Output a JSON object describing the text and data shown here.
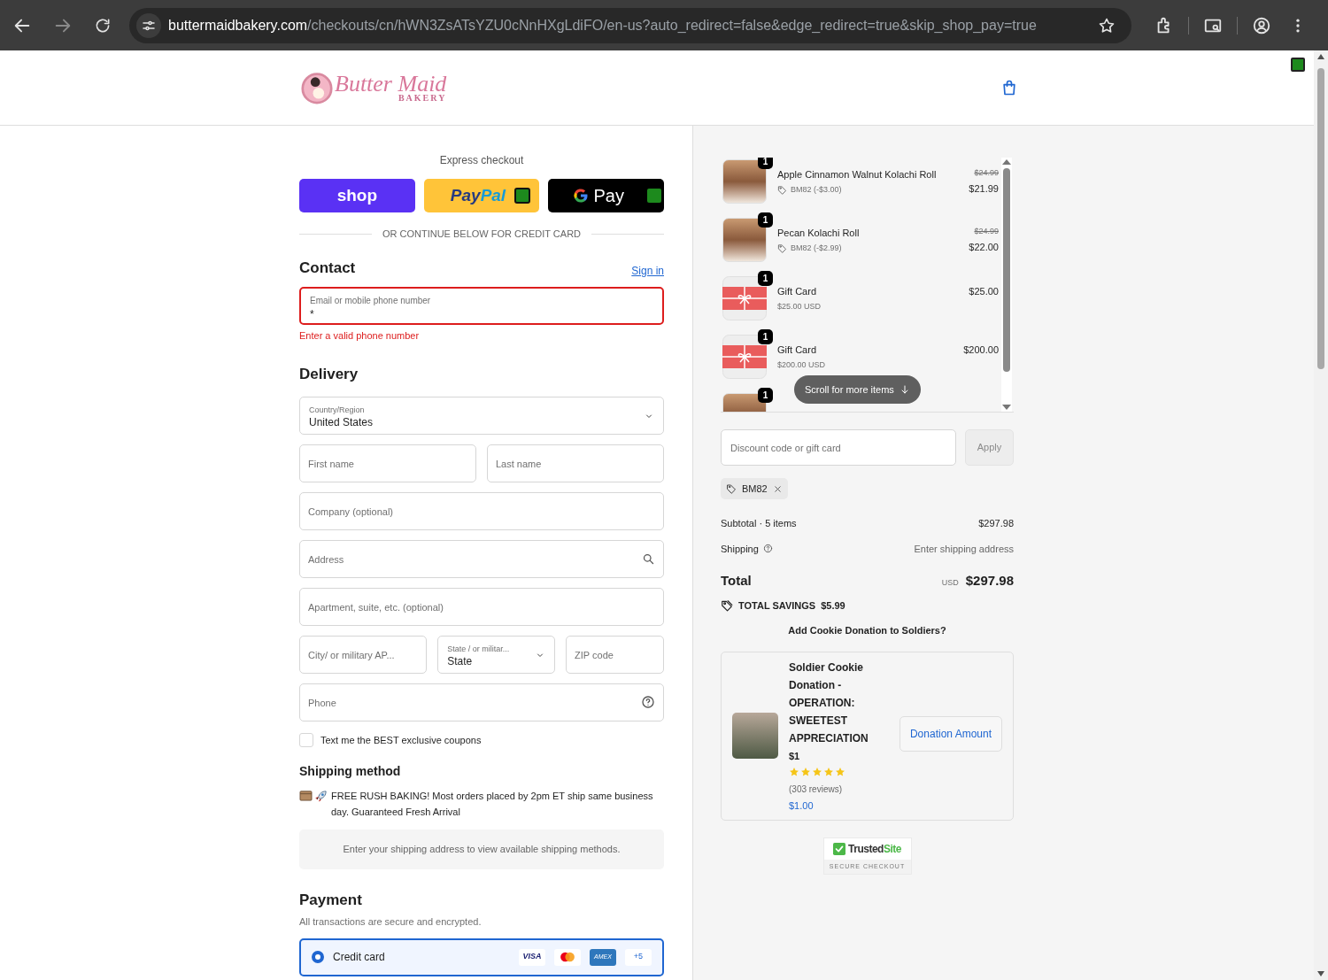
{
  "browser": {
    "url_host": "buttermaidbakery.com",
    "url_rest": "/checkouts/cn/hWN3ZsATsYZU0cNnHXgLdiFO/en-us?auto_redirect=false&edge_redirect=true&skip_shop_pay=true"
  },
  "header": {
    "logo_script": "Butter Maid",
    "logo_sub": "BAKERY"
  },
  "express": {
    "title": "Express checkout",
    "divider": "OR CONTINUE BELOW FOR CREDIT CARD",
    "buttons": [
      {
        "kind": "shop",
        "parts": [
          "shop"
        ]
      },
      {
        "kind": "paypal",
        "parts": [
          "Pay",
          "Pal"
        ]
      },
      {
        "kind": "gpay",
        "parts": [
          "Pay"
        ]
      }
    ]
  },
  "contact": {
    "title": "Contact",
    "sign_in": "Sign in",
    "field": {
      "label": "Email or mobile phone number",
      "value": "*",
      "invalid": true
    },
    "error": "Enter a valid phone number"
  },
  "delivery": {
    "title": "Delivery",
    "rows": [
      [
        {
          "kind": "select",
          "label": "Country/Region",
          "value": "United States"
        }
      ],
      [
        {
          "kind": "text",
          "placeholder": "First name"
        },
        {
          "kind": "text",
          "placeholder": "Last name"
        }
      ],
      [
        {
          "kind": "text",
          "placeholder": "Company (optional)"
        }
      ],
      [
        {
          "kind": "search",
          "placeholder": "Address"
        }
      ],
      [
        {
          "kind": "text",
          "placeholder": "Apartment, suite, etc. (optional)"
        }
      ],
      [
        {
          "kind": "text",
          "placeholder": "City/ or military AP..."
        },
        {
          "kind": "select",
          "label": "State / or militar...",
          "value": "State"
        },
        {
          "kind": "text",
          "placeholder": "ZIP code"
        }
      ],
      [
        {
          "kind": "help",
          "placeholder": "Phone"
        }
      ]
    ],
    "checkbox": {
      "label": "Text me the BEST exclusive coupons",
      "checked": false
    }
  },
  "shipping_method": {
    "title": "Shipping method",
    "note": "FREE RUSH BAKING! Most orders placed by 2pm ET ship same business day. Guaranteed Fresh Arrival",
    "info": "Enter your shipping address to view available shipping methods."
  },
  "payment": {
    "title": "Payment",
    "subtitle": "All transactions are secure and encrypted.",
    "options": [
      {
        "label": "Credit card",
        "selected": true,
        "cards": [
          {
            "kind": "visa",
            "text": "VISA"
          },
          {
            "kind": "mastercard"
          },
          {
            "kind": "amex",
            "text": "AMEX"
          },
          {
            "kind": "more",
            "text": "+5"
          }
        ]
      }
    ]
  },
  "cart": {
    "items": [
      {
        "kind": "photo",
        "qty": "1",
        "name": "Apple Cinnamon Walnut Kolachi Roll",
        "discount": "BM82 (-$3.00)",
        "original": "$24.99",
        "price": "$21.99"
      },
      {
        "kind": "photo",
        "qty": "1",
        "name": "Pecan Kolachi Roll",
        "discount": "BM82 (-$2.99)",
        "original": "$24.99",
        "price": "$22.00"
      },
      {
        "kind": "giftcard",
        "qty": "1",
        "name": "Gift Card",
        "sub": "$25.00 USD",
        "price": "$25.00"
      },
      {
        "kind": "giftcard",
        "qty": "1",
        "name": "Gift Card",
        "sub": "$200.00 USD",
        "price": "$200.00"
      },
      {
        "kind": "photo",
        "qty": "1"
      }
    ],
    "scroll_hint": "Scroll for more items"
  },
  "discount": {
    "placeholder": "Discount code or gift card",
    "apply": "Apply",
    "apply_disabled": true,
    "tags": [
      "BM82"
    ]
  },
  "summary": {
    "subtotal_label": "Subtotal · 5 items",
    "subtotal": "$297.98",
    "shipping_label": "Shipping",
    "shipping": "Enter shipping address",
    "total_label": "Total",
    "currency": "USD",
    "total": "$297.98",
    "savings_label": "TOTAL SAVINGS",
    "savings": "$5.99"
  },
  "upsell": {
    "title": "Add Cookie Donation to Soldiers?",
    "name": "Soldier Cookie Donation - OPERATION: SWEETEST APPRECIATION",
    "price": "$1",
    "stars": 5,
    "reviews": "(303 reviews)",
    "amount": "$1.00",
    "button": "Donation Amount"
  },
  "trust": {
    "brand_a": "Trusted",
    "brand_b": "Site",
    "caption": "SECURE CHECKOUT"
  }
}
